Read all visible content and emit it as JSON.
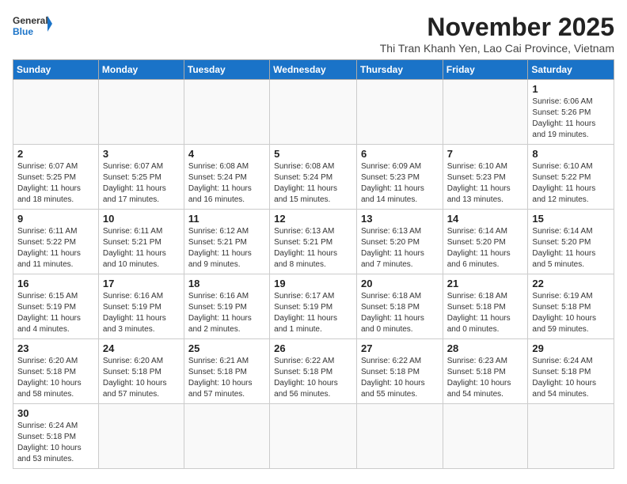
{
  "logo": {
    "line1": "General",
    "line2": "Blue"
  },
  "title": "November 2025",
  "subtitle": "Thi Tran Khanh Yen, Lao Cai Province, Vietnam",
  "days_of_week": [
    "Sunday",
    "Monday",
    "Tuesday",
    "Wednesday",
    "Thursday",
    "Friday",
    "Saturday"
  ],
  "weeks": [
    [
      {
        "day": "",
        "info": ""
      },
      {
        "day": "",
        "info": ""
      },
      {
        "day": "",
        "info": ""
      },
      {
        "day": "",
        "info": ""
      },
      {
        "day": "",
        "info": ""
      },
      {
        "day": "",
        "info": ""
      },
      {
        "day": "1",
        "info": "Sunrise: 6:06 AM\nSunset: 5:26 PM\nDaylight: 11 hours and 19 minutes."
      }
    ],
    [
      {
        "day": "2",
        "info": "Sunrise: 6:07 AM\nSunset: 5:25 PM\nDaylight: 11 hours and 18 minutes."
      },
      {
        "day": "3",
        "info": "Sunrise: 6:07 AM\nSunset: 5:25 PM\nDaylight: 11 hours and 17 minutes."
      },
      {
        "day": "4",
        "info": "Sunrise: 6:08 AM\nSunset: 5:24 PM\nDaylight: 11 hours and 16 minutes."
      },
      {
        "day": "5",
        "info": "Sunrise: 6:08 AM\nSunset: 5:24 PM\nDaylight: 11 hours and 15 minutes."
      },
      {
        "day": "6",
        "info": "Sunrise: 6:09 AM\nSunset: 5:23 PM\nDaylight: 11 hours and 14 minutes."
      },
      {
        "day": "7",
        "info": "Sunrise: 6:10 AM\nSunset: 5:23 PM\nDaylight: 11 hours and 13 minutes."
      },
      {
        "day": "8",
        "info": "Sunrise: 6:10 AM\nSunset: 5:22 PM\nDaylight: 11 hours and 12 minutes."
      }
    ],
    [
      {
        "day": "9",
        "info": "Sunrise: 6:11 AM\nSunset: 5:22 PM\nDaylight: 11 hours and 11 minutes."
      },
      {
        "day": "10",
        "info": "Sunrise: 6:11 AM\nSunset: 5:21 PM\nDaylight: 11 hours and 10 minutes."
      },
      {
        "day": "11",
        "info": "Sunrise: 6:12 AM\nSunset: 5:21 PM\nDaylight: 11 hours and 9 minutes."
      },
      {
        "day": "12",
        "info": "Sunrise: 6:13 AM\nSunset: 5:21 PM\nDaylight: 11 hours and 8 minutes."
      },
      {
        "day": "13",
        "info": "Sunrise: 6:13 AM\nSunset: 5:20 PM\nDaylight: 11 hours and 7 minutes."
      },
      {
        "day": "14",
        "info": "Sunrise: 6:14 AM\nSunset: 5:20 PM\nDaylight: 11 hours and 6 minutes."
      },
      {
        "day": "15",
        "info": "Sunrise: 6:14 AM\nSunset: 5:20 PM\nDaylight: 11 hours and 5 minutes."
      }
    ],
    [
      {
        "day": "16",
        "info": "Sunrise: 6:15 AM\nSunset: 5:19 PM\nDaylight: 11 hours and 4 minutes."
      },
      {
        "day": "17",
        "info": "Sunrise: 6:16 AM\nSunset: 5:19 PM\nDaylight: 11 hours and 3 minutes."
      },
      {
        "day": "18",
        "info": "Sunrise: 6:16 AM\nSunset: 5:19 PM\nDaylight: 11 hours and 2 minutes."
      },
      {
        "day": "19",
        "info": "Sunrise: 6:17 AM\nSunset: 5:19 PM\nDaylight: 11 hours and 1 minute."
      },
      {
        "day": "20",
        "info": "Sunrise: 6:18 AM\nSunset: 5:18 PM\nDaylight: 11 hours and 0 minutes."
      },
      {
        "day": "21",
        "info": "Sunrise: 6:18 AM\nSunset: 5:18 PM\nDaylight: 11 hours and 0 minutes."
      },
      {
        "day": "22",
        "info": "Sunrise: 6:19 AM\nSunset: 5:18 PM\nDaylight: 10 hours and 59 minutes."
      }
    ],
    [
      {
        "day": "23",
        "info": "Sunrise: 6:20 AM\nSunset: 5:18 PM\nDaylight: 10 hours and 58 minutes."
      },
      {
        "day": "24",
        "info": "Sunrise: 6:20 AM\nSunset: 5:18 PM\nDaylight: 10 hours and 57 minutes."
      },
      {
        "day": "25",
        "info": "Sunrise: 6:21 AM\nSunset: 5:18 PM\nDaylight: 10 hours and 57 minutes."
      },
      {
        "day": "26",
        "info": "Sunrise: 6:22 AM\nSunset: 5:18 PM\nDaylight: 10 hours and 56 minutes."
      },
      {
        "day": "27",
        "info": "Sunrise: 6:22 AM\nSunset: 5:18 PM\nDaylight: 10 hours and 55 minutes."
      },
      {
        "day": "28",
        "info": "Sunrise: 6:23 AM\nSunset: 5:18 PM\nDaylight: 10 hours and 54 minutes."
      },
      {
        "day": "29",
        "info": "Sunrise: 6:24 AM\nSunset: 5:18 PM\nDaylight: 10 hours and 54 minutes."
      }
    ],
    [
      {
        "day": "30",
        "info": "Sunrise: 6:24 AM\nSunset: 5:18 PM\nDaylight: 10 hours and 53 minutes."
      },
      {
        "day": "",
        "info": ""
      },
      {
        "day": "",
        "info": ""
      },
      {
        "day": "",
        "info": ""
      },
      {
        "day": "",
        "info": ""
      },
      {
        "day": "",
        "info": ""
      },
      {
        "day": "",
        "info": ""
      }
    ]
  ]
}
